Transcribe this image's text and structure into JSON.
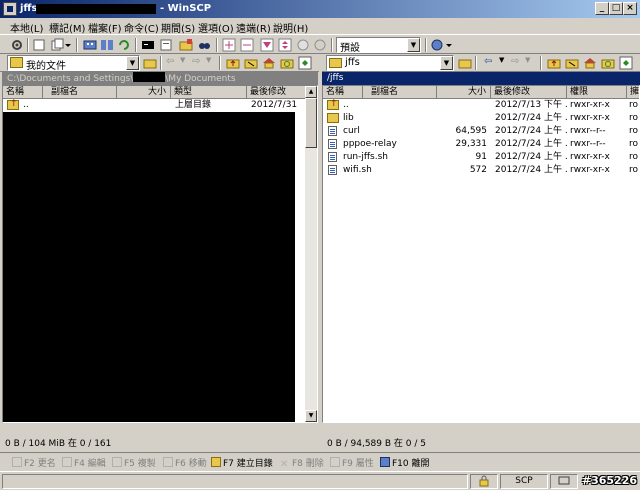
{
  "window": {
    "title": "jffs - ",
    "app_name": " - WinSCP"
  },
  "menu": [
    {
      "label": "本地(L)"
    },
    {
      "label": "標記(M)"
    },
    {
      "label": "檔案(F)"
    },
    {
      "label": "命令(C)"
    },
    {
      "label": "期間(S)"
    },
    {
      "label": "選項(O)"
    },
    {
      "label": "遠端(R)"
    },
    {
      "label": "說明(H)"
    }
  ],
  "toolbar": {
    "profile_value": "預設"
  },
  "left_panel": {
    "drive_value": "我的文件",
    "path_prefix": "C:\\Documents and Settings\\",
    "path_suffix": "\\My Documents",
    "columns": [
      "名稱",
      "副檔名",
      "大小",
      "類型",
      "最後修改"
    ],
    "rows": [
      {
        "name": "..",
        "ext": "",
        "size": "",
        "type": "上層目錄",
        "modified": "2012/7/31",
        "icon": "parent-folder-icon"
      }
    ],
    "status": "0 B / 104 MiB 在 0 / 161"
  },
  "right_panel": {
    "dir_value": "jffs",
    "path": "/jffs",
    "columns": [
      "名稱",
      "副檔名",
      "大小",
      "最後修改",
      "權限",
      "擁"
    ],
    "rows": [
      {
        "name": "..",
        "ext": "",
        "size": "",
        "modified": "2012/7/13 下午 ...",
        "perm": "rwxr-xr-x",
        "owner": "ro",
        "icon": "parent-folder-icon"
      },
      {
        "name": "lib",
        "ext": "",
        "size": "",
        "modified": "2012/7/24 上午 ...",
        "perm": "rwxr-xr-x",
        "owner": "ro",
        "icon": "folder-icon"
      },
      {
        "name": "curl",
        "ext": "",
        "size": "64,595",
        "modified": "2012/7/24 上午 ...",
        "perm": "rwxr--r--",
        "owner": "ro",
        "icon": "file-icon"
      },
      {
        "name": "pppoe-relay",
        "ext": "",
        "size": "29,331",
        "modified": "2012/7/24 上午 ...",
        "perm": "rwxr--r--",
        "owner": "ro",
        "icon": "file-icon"
      },
      {
        "name": "run-jffs.sh",
        "ext": "",
        "size": "91",
        "modified": "2012/7/24 上午 ...",
        "perm": "rwxr-xr-x",
        "owner": "ro",
        "icon": "file-icon"
      },
      {
        "name": "wifi.sh",
        "ext": "",
        "size": "572",
        "modified": "2012/7/24 上午 ...",
        "perm": "rwxr-xr-x",
        "owner": "ro",
        "icon": "file-icon"
      }
    ],
    "status": "0 B / 94,589 B 在 0 / 5"
  },
  "fkeys": [
    {
      "label": "F2 更名",
      "enabled": false
    },
    {
      "label": "F4 編輯",
      "enabled": false
    },
    {
      "label": "F5 複製",
      "enabled": false
    },
    {
      "label": "F6 移動",
      "enabled": false
    },
    {
      "label": "F7 建立目錄",
      "enabled": true
    },
    {
      "label": "F8 刪除",
      "enabled": false
    },
    {
      "label": "F9 屬性",
      "enabled": false
    },
    {
      "label": "F10 離開",
      "enabled": true
    }
  ],
  "statusbar": {
    "protocol": "SCP",
    "watermark": "#365226"
  }
}
